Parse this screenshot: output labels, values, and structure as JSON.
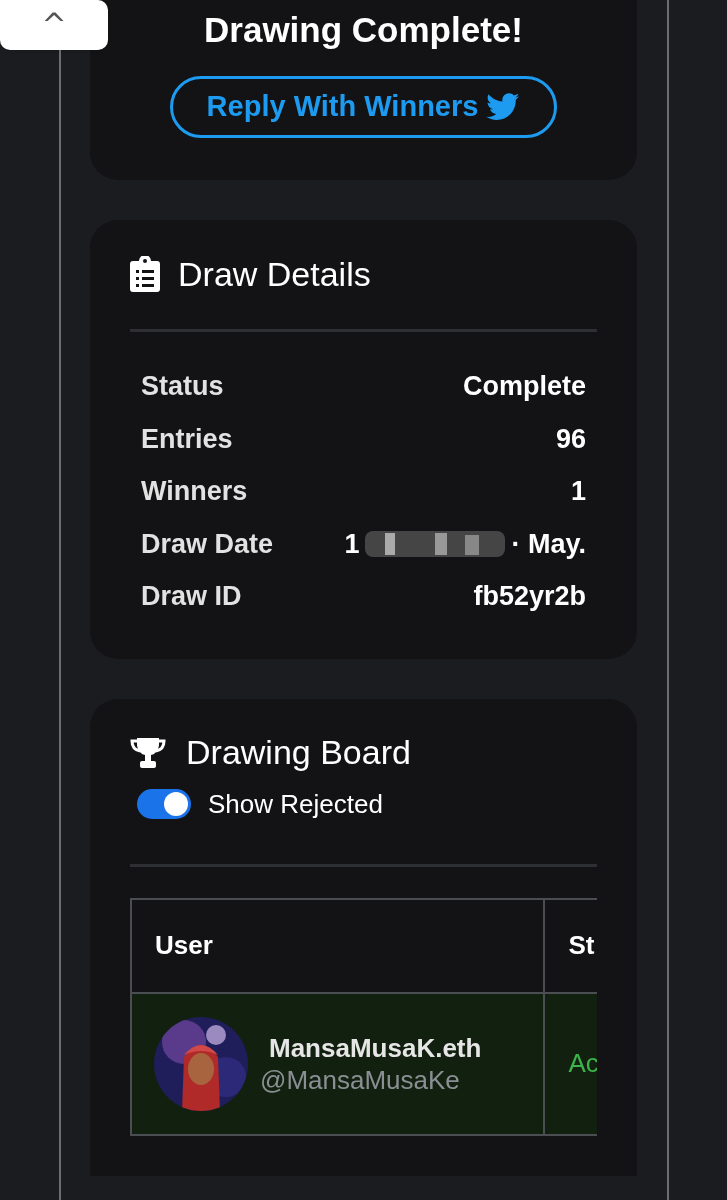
{
  "scroll_top_button": {
    "label": "^"
  },
  "result_card": {
    "title": "Drawing Complete!",
    "button": "Reply With Winners"
  },
  "draw_details": {
    "title": "Draw Details",
    "rows": [
      {
        "label": "Status",
        "value": "Complete"
      },
      {
        "label": "Entries",
        "value": "96"
      },
      {
        "label": "Winners",
        "value": "1"
      },
      {
        "label": "Draw Date",
        "value": "1",
        "value_end": "· May.",
        "kind": "redacted"
      },
      {
        "label": "Draw ID",
        "value": "fb52yr2b"
      }
    ]
  },
  "drawing_board": {
    "title": "Drawing Board",
    "toggle": {
      "label": "Show Rejected",
      "on": true
    },
    "table": {
      "columns": [
        "User",
        "St"
      ],
      "rows": [
        {
          "name": "MansaMusaK.eth",
          "handle": "@MansaMusaKe",
          "status": "Ac"
        }
      ]
    }
  }
}
